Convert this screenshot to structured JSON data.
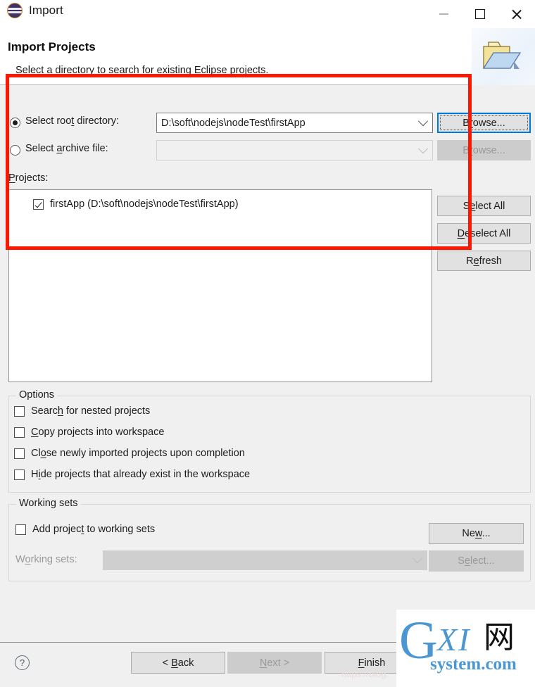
{
  "window": {
    "title": "Import",
    "app_icon": "eclipse-icon",
    "controls": {
      "minimize": "minimize-icon",
      "maximize": "maximize-icon",
      "close": "close-icon"
    }
  },
  "banner": {
    "title": "Import Projects",
    "description": "Select a directory to search for existing Eclipse projects.",
    "icon": "folder-icon"
  },
  "source": {
    "root_directory": {
      "label_before": "Select roo",
      "label_mnemonic": "t",
      "label_after": " directory:",
      "selected": true,
      "value": "D:\\soft\\nodejs\\nodeTest\\firstApp",
      "browse_label_before": "B",
      "browse_mnemonic": "r",
      "browse_label_after": "owse...",
      "browse_enabled": true,
      "browse_focused": true
    },
    "archive_file": {
      "label_before": "Select ",
      "label_mnemonic": "a",
      "label_after": "rchive file:",
      "selected": false,
      "value": "",
      "enabled": false,
      "browse_label_before": "B",
      "browse_mnemonic": "r",
      "browse_label_after": "owse...",
      "browse_enabled": false
    }
  },
  "projects": {
    "label_mnemonic": "P",
    "label_after": "rojects:",
    "items": [
      {
        "label": "firstApp (D:\\soft\\nodejs\\nodeTest\\firstApp)",
        "checked": true
      }
    ],
    "buttons": [
      {
        "name": "select-all",
        "before": "S",
        "mnemonic": "e",
        "after": "lect All",
        "enabled": true
      },
      {
        "name": "deselect-all",
        "before": "",
        "mnemonic": "D",
        "after": "eselect All",
        "enabled": true
      },
      {
        "name": "refresh",
        "before": "R",
        "mnemonic": "e",
        "after": "fresh",
        "enabled": true
      }
    ]
  },
  "options": {
    "group_title": "Options",
    "items": [
      {
        "before": "Searc",
        "mnemonic": "h",
        "after": " for nested projects",
        "checked": false
      },
      {
        "before": "",
        "mnemonic": "C",
        "after": "opy projects into workspace",
        "checked": false
      },
      {
        "before": "Cl",
        "mnemonic": "o",
        "after": "se newly imported projects upon completion",
        "checked": false
      },
      {
        "before": "H",
        "mnemonic": "i",
        "after": "de projects that already exist in the workspace",
        "checked": false
      }
    ]
  },
  "working_sets": {
    "group_title": "Working sets",
    "add_checkbox": {
      "before": "Add projec",
      "mnemonic": "t",
      "after": " to working sets",
      "checked": false
    },
    "new_button": {
      "before": "Ne",
      "mnemonic": "w",
      "after": "...",
      "enabled": true
    },
    "combo_label": {
      "before": "W",
      "mnemonic": "o",
      "after": "rking sets:",
      "enabled": false
    },
    "combo_value": "",
    "combo_enabled": false,
    "select_button": {
      "before": "S",
      "mnemonic": "e",
      "after": "lect...",
      "enabled": false
    }
  },
  "footer": {
    "help_icon": "help-icon",
    "buttons": [
      {
        "name": "back",
        "before": "< ",
        "mnemonic": "B",
        "after": "ack",
        "enabled": true
      },
      {
        "name": "next",
        "before": "",
        "mnemonic": "N",
        "after": "ext >",
        "enabled": false
      },
      {
        "name": "finish",
        "before": "",
        "mnemonic": "F",
        "after": "inish",
        "enabled": true
      }
    ]
  },
  "annotation": {
    "shape": "rectangle",
    "color": "#fb1700"
  },
  "watermark": {
    "g": "G",
    "xi": "XI",
    "cjk": "网",
    "system": "system.com",
    "url": "https://blog."
  }
}
